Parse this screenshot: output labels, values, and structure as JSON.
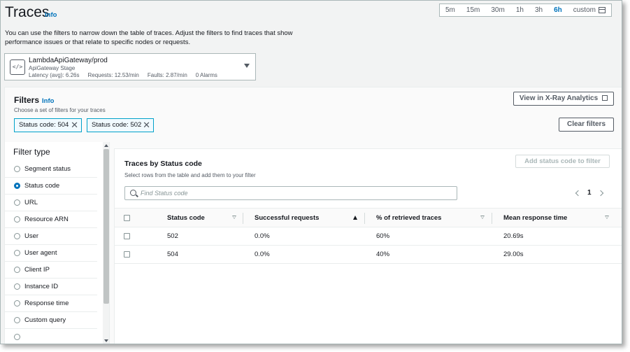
{
  "page": {
    "title": "Traces",
    "info_label": "Info",
    "description": "You can use the filters to narrow down the table of traces. Adjust the filters to find traces that show performance issues or that relate to specific nodes or requests."
  },
  "time_range": {
    "options": [
      "5m",
      "15m",
      "30m",
      "1h",
      "3h",
      "6h"
    ],
    "selected": "6h",
    "custom_label": "custom"
  },
  "node": {
    "name": "LambdaApiGateway/prod",
    "type": "ApiGateway Stage",
    "latency": "Latency (avg): 6.26s",
    "requests": "Requests: 12.53/min",
    "faults": "Faults: 2.87/min",
    "alarms": "0 Alarms"
  },
  "filters": {
    "title": "Filters",
    "info_label": "Info",
    "subtitle": "Choose a set of filters for your traces",
    "analytics_button": "View in X-Ray Analytics",
    "clear_button": "Clear filters",
    "tokens": [
      "Status code: 504",
      "Status code: 502"
    ]
  },
  "filter_type": {
    "title": "Filter type",
    "selected": "Status code",
    "items": [
      "Segment status",
      "Status code",
      "URL",
      "Resource ARN",
      "User",
      "User agent",
      "Client IP",
      "Instance ID",
      "Response time",
      "Custom query"
    ]
  },
  "traces": {
    "title": "Traces by Status code",
    "subtitle": "Select rows from the table and add them to your filter",
    "add_button": "Add status code to filter",
    "search_placeholder": "Find Status code",
    "page": "1",
    "columns": [
      "Status code",
      "Successful requests",
      "% of retrieved traces",
      "Mean response time"
    ],
    "sorted_column": "Successful requests",
    "sort_direction": "ascending",
    "rows": [
      [
        "502",
        "0.0%",
        "60%",
        "20.69s"
      ],
      [
        "504",
        "0.0%",
        "40%",
        "29.00s"
      ]
    ]
  },
  "colors": {
    "accent": "#0073bb",
    "token_border": "#00a1c9",
    "page_bg": "#f2f3f3"
  }
}
